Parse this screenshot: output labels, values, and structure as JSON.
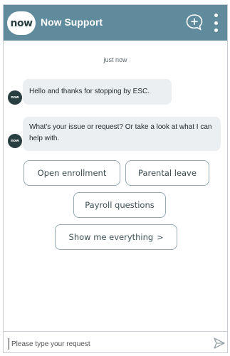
{
  "header": {
    "logo_text": "now",
    "title": "Now Support",
    "new_chat_icon": "chat-plus-icon",
    "menu_icon": "kebab-menu-icon",
    "bg_color": "#5f8b9c"
  },
  "conversation": {
    "timestamp": "just now",
    "messages": [
      {
        "sender": "bot",
        "text": "Hello and thanks for stopping by ESC."
      },
      {
        "sender": "bot",
        "text": "What's your issue or request? Or take a look at what I can help with."
      }
    ],
    "bot_avatar_text": "now"
  },
  "quick_replies": [
    {
      "label": "Open enrollment"
    },
    {
      "label": "Parental leave"
    },
    {
      "label": "Payroll questions"
    },
    {
      "label": "Show me everything",
      "chevron": ">"
    }
  ],
  "composer": {
    "placeholder": "Please type your request",
    "value": "",
    "send_icon": "send-arrow-icon"
  }
}
